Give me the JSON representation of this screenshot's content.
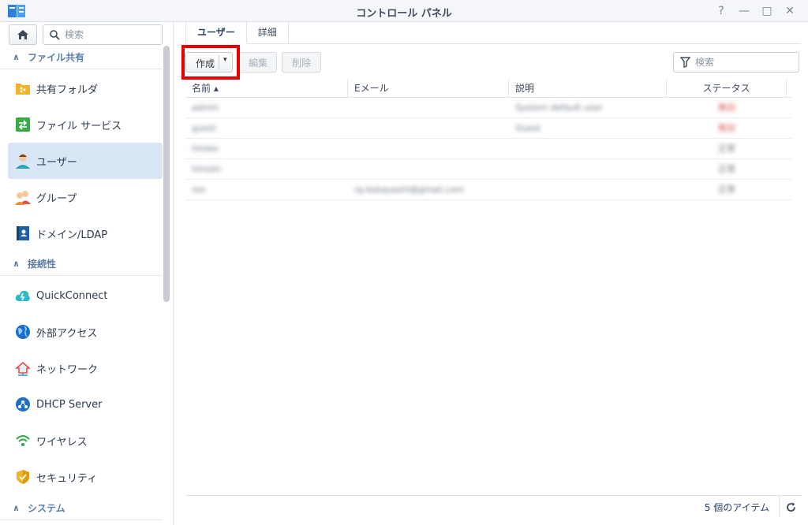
{
  "window": {
    "title": "コントロール パネル",
    "controls": [
      "?",
      "—",
      "□",
      "✕"
    ]
  },
  "sidebar": {
    "search_placeholder": "検索",
    "sections": [
      {
        "label": "ファイル共有"
      },
      {
        "label": "接続性"
      },
      {
        "label": "システム"
      }
    ],
    "items": [
      {
        "label": "共有フォルダ",
        "icon": "shared-folder-icon"
      },
      {
        "label": "ファイル サービス",
        "icon": "file-services-icon"
      },
      {
        "label": "ユーザー",
        "icon": "user-icon",
        "active": true
      },
      {
        "label": "グループ",
        "icon": "group-icon"
      },
      {
        "label": "ドメイン/LDAP",
        "icon": "domain-ldap-icon"
      },
      {
        "label": "QuickConnect",
        "icon": "quickconnect-icon"
      },
      {
        "label": "外部アクセス",
        "icon": "external-access-icon"
      },
      {
        "label": "ネットワーク",
        "icon": "network-icon"
      },
      {
        "label": "DHCP Server",
        "icon": "dhcp-server-icon"
      },
      {
        "label": "ワイヤレス",
        "icon": "wireless-icon"
      },
      {
        "label": "セキュリティ",
        "icon": "security-icon"
      }
    ]
  },
  "main": {
    "tabs": [
      {
        "label": "ユーザー",
        "active": true
      },
      {
        "label": "詳細"
      }
    ],
    "toolbar": {
      "create_label": "作成",
      "edit_label": "編集",
      "delete_label": "削除"
    },
    "filter_placeholder": "検索",
    "columns": [
      "名前 ▴",
      "Eメール",
      "説明",
      "ステータス"
    ],
    "rows": [
      {
        "name": "admin",
        "email": "",
        "description": "System default user",
        "status": "無効"
      },
      {
        "name": "guest",
        "email": "",
        "description": "Guest",
        "status": "無効"
      },
      {
        "name": "hiroko",
        "email": "",
        "description": "",
        "status": "正常"
      },
      {
        "name": "hiroshi",
        "email": "",
        "description": "",
        "status": "正常"
      },
      {
        "name": "rex",
        "email": "rg.kobayashi@gmail.com",
        "description": "",
        "status": "正常"
      }
    ],
    "footer_count": "5 個のアイテム"
  },
  "colors": {
    "accent": "#5d7ea6",
    "active_bg": "#d8e6f6",
    "highlight": "#e60000"
  }
}
